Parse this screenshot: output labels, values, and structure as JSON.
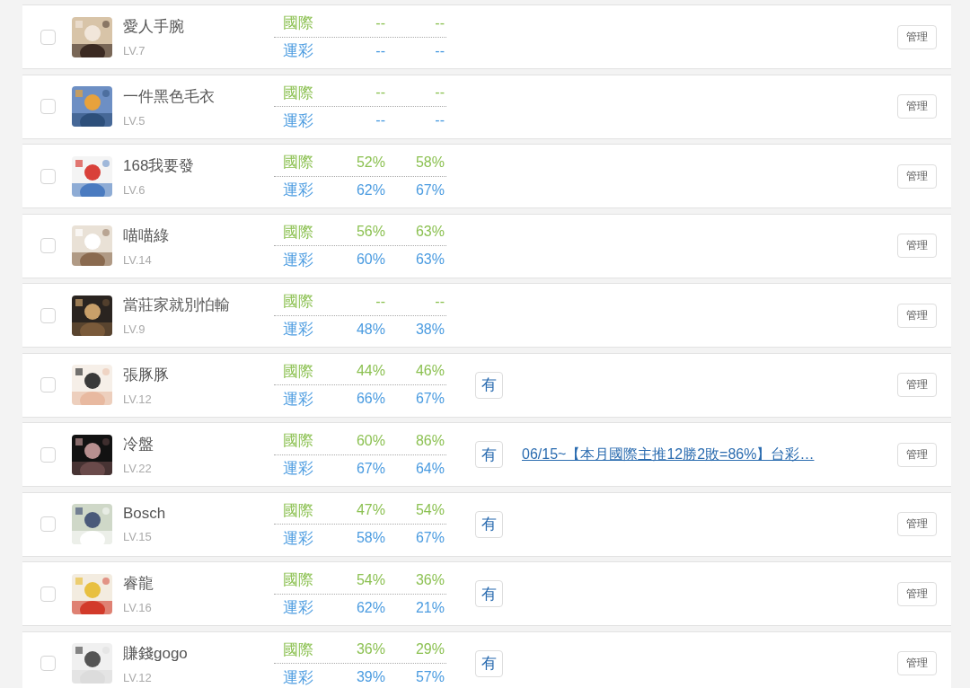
{
  "rows": [
    {
      "checked": false,
      "name": "愛人手腕",
      "level_text": "LV.7",
      "stats": [
        {
          "kind": "intl",
          "label": "國際",
          "values": [
            "--",
            "--"
          ]
        },
        {
          "kind": "lottery",
          "label": "運彩",
          "values": [
            "--",
            "--"
          ]
        }
      ],
      "manage": "管理"
    },
    {
      "checked": false,
      "name": "一件黑色毛衣",
      "level_text": "LV.5",
      "stats": [
        {
          "kind": "intl",
          "label": "國際",
          "values": [
            "--",
            "--"
          ]
        },
        {
          "kind": "lottery",
          "label": "運彩",
          "values": [
            "--",
            "--"
          ]
        }
      ],
      "manage": "管理"
    },
    {
      "checked": false,
      "name": "168我要發",
      "level_text": "LV.6",
      "stats": [
        {
          "kind": "intl",
          "label": "國際",
          "values": [
            "52%",
            "58%"
          ]
        },
        {
          "kind": "lottery",
          "label": "運彩",
          "values": [
            "62%",
            "67%"
          ]
        }
      ],
      "manage": "管理"
    },
    {
      "checked": false,
      "name": "喵喵綠",
      "level_text": "LV.14",
      "stats": [
        {
          "kind": "intl",
          "label": "國際",
          "values": [
            "56%",
            "63%"
          ]
        },
        {
          "kind": "lottery",
          "label": "運彩",
          "values": [
            "60%",
            "63%"
          ]
        }
      ],
      "manage": "管理"
    },
    {
      "checked": false,
      "name": "當莊家就別怕輸",
      "level_text": "LV.9",
      "stats": [
        {
          "kind": "intl",
          "label": "國際",
          "values": [
            "--",
            "--"
          ]
        },
        {
          "kind": "lottery",
          "label": "運彩",
          "values": [
            "48%",
            "38%"
          ]
        }
      ],
      "manage": "管理"
    },
    {
      "checked": false,
      "name": "張豚豚",
      "level_text": "LV.12",
      "stats": [
        {
          "kind": "intl",
          "label": "國際",
          "values": [
            "44%",
            "46%"
          ]
        },
        {
          "kind": "lottery",
          "label": "運彩",
          "values": [
            "66%",
            "67%"
          ]
        }
      ],
      "flag": "有",
      "manage": "管理"
    },
    {
      "checked": false,
      "name": "冷盤",
      "level_text": "LV.22",
      "stats": [
        {
          "kind": "intl",
          "label": "國際",
          "values": [
            "60%",
            "86%"
          ]
        },
        {
          "kind": "lottery",
          "label": "運彩",
          "values": [
            "67%",
            "64%"
          ]
        }
      ],
      "flag": "有",
      "link": "06/15~【本月國際主推12勝2敗=86%】台彩…",
      "manage": "管理"
    },
    {
      "checked": false,
      "name": "Bosch",
      "level_text": "LV.15",
      "stats": [
        {
          "kind": "intl",
          "label": "國際",
          "values": [
            "47%",
            "54%"
          ]
        },
        {
          "kind": "lottery",
          "label": "運彩",
          "values": [
            "58%",
            "67%"
          ]
        }
      ],
      "flag": "有",
      "manage": "管理"
    },
    {
      "checked": false,
      "name": "睿龍",
      "level_text": "LV.16",
      "stats": [
        {
          "kind": "intl",
          "label": "國際",
          "values": [
            "54%",
            "36%"
          ]
        },
        {
          "kind": "lottery",
          "label": "運彩",
          "values": [
            "62%",
            "21%"
          ]
        }
      ],
      "flag": "有",
      "manage": "管理"
    },
    {
      "checked": false,
      "name": "賺錢gogo",
      "level_text": "LV.12",
      "stats": [
        {
          "kind": "intl",
          "label": "國際",
          "values": [
            "36%",
            "29%"
          ]
        },
        {
          "kind": "lottery",
          "label": "運彩",
          "values": [
            "39%",
            "57%"
          ]
        }
      ],
      "flag": "有",
      "manage": "管理"
    }
  ]
}
